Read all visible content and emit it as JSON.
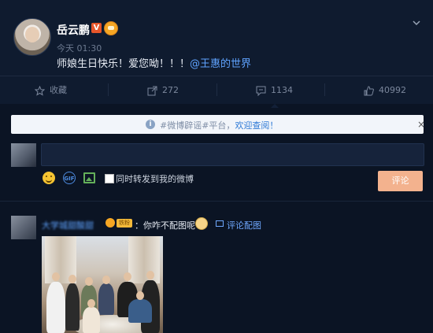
{
  "post": {
    "username": "岳云鹏",
    "verified_badge": "V",
    "time": "今天 01:30",
    "text": "师娘生日快乐！爱您呦！！！",
    "mention": "@王惠的世界"
  },
  "actions": {
    "favorite": "收藏",
    "repost_count": "272",
    "comment_count": "1134",
    "like_count": "40992"
  },
  "notice": {
    "text": "#微博辟谣#平台，",
    "link": "欢迎查阅！",
    "close": "×"
  },
  "composer": {
    "input_value": "",
    "gif_label": "GIF",
    "forward_label": "同时转发到我的微博",
    "submit_label": "评论"
  },
  "comment": {
    "username": "大学城甜酸甜",
    "badge_text": "铁粉",
    "text": "：你咋不配图呢",
    "pic_link": "评论配图"
  },
  "colors": {
    "background": "#0b1424",
    "link": "#5fa3ff",
    "submit_button": "#f3b28e"
  }
}
